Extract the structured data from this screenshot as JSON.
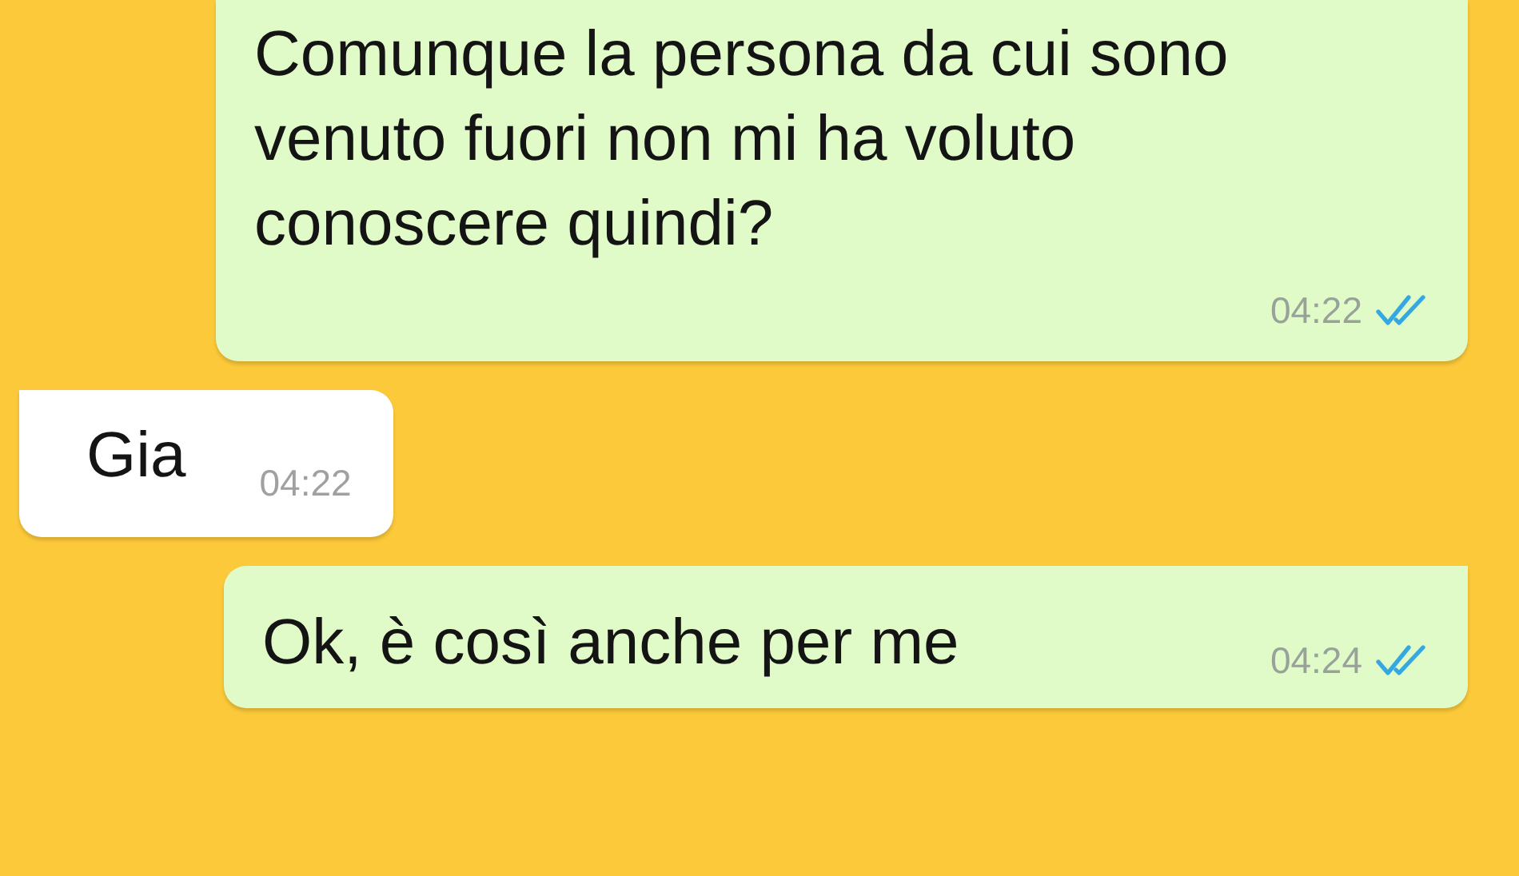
{
  "messages": [
    {
      "kind": "outgoing",
      "text": "Comunque la persona da cui sono venuto fuori non mi ha voluto conoscere quindi?",
      "time": "04:22",
      "read": true
    },
    {
      "kind": "incoming",
      "text": "Gia",
      "time": "04:22"
    },
    {
      "kind": "outgoing",
      "text": "Ok, è così anche per me",
      "time": "04:24",
      "read": true
    }
  ]
}
